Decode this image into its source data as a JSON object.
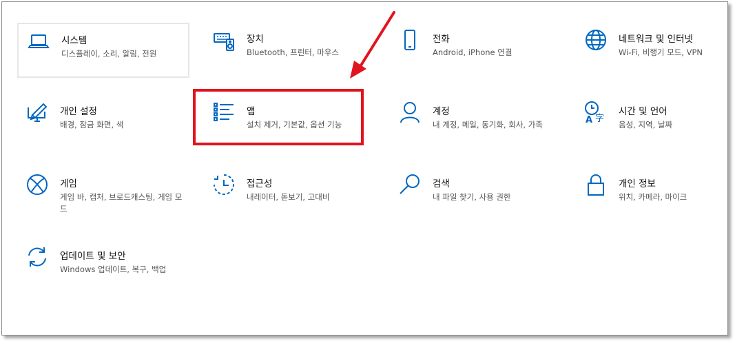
{
  "accent_color": "#0067c0",
  "highlight_color": "#e2131e",
  "tiles": [
    {
      "id": "system",
      "icon": "laptop-icon",
      "title": "시스템",
      "desc": "디스플레이, 소리, 알림, 전원"
    },
    {
      "id": "devices",
      "icon": "keyboard-speaker-icon",
      "title": "장치",
      "desc": "Bluetooth, 프린터, 마우스"
    },
    {
      "id": "phone",
      "icon": "phone-icon",
      "title": "전화",
      "desc": "Android, iPhone 연결"
    },
    {
      "id": "network",
      "icon": "globe-icon",
      "title": "네트워크 및 인터넷",
      "desc": "Wi-Fi, 비행기 모드, VPN"
    },
    {
      "id": "personalization",
      "icon": "pen-monitor-icon",
      "title": "개인 설정",
      "desc": "배경, 잠금 화면, 색"
    },
    {
      "id": "apps",
      "icon": "apps-list-icon",
      "title": "앱",
      "desc": "설치 제거, 기본값, 옵션 기능"
    },
    {
      "id": "accounts",
      "icon": "person-icon",
      "title": "계정",
      "desc": "내 계정, 메일, 동기화, 회사, 가족"
    },
    {
      "id": "time-language",
      "icon": "time-language-icon",
      "title": "시간 및 언어",
      "desc": "음성, 지역, 날짜"
    },
    {
      "id": "gaming",
      "icon": "xbox-icon",
      "title": "게임",
      "desc": "게임 바, 캡처, 브로드캐스팅, 게임 모드"
    },
    {
      "id": "ease-of-access",
      "icon": "ease-of-access-icon",
      "title": "접근성",
      "desc": "내레이터, 돋보기, 고대비"
    },
    {
      "id": "search",
      "icon": "search-icon",
      "title": "검색",
      "desc": "내 파일 찾기, 사용 권한"
    },
    {
      "id": "privacy",
      "icon": "lock-icon",
      "title": "개인 정보",
      "desc": "위치, 카메라, 마이크"
    },
    {
      "id": "update-security",
      "icon": "sync-icon",
      "title": "업데이트 및 보안",
      "desc": "Windows 업데이트, 복구, 백업"
    }
  ]
}
